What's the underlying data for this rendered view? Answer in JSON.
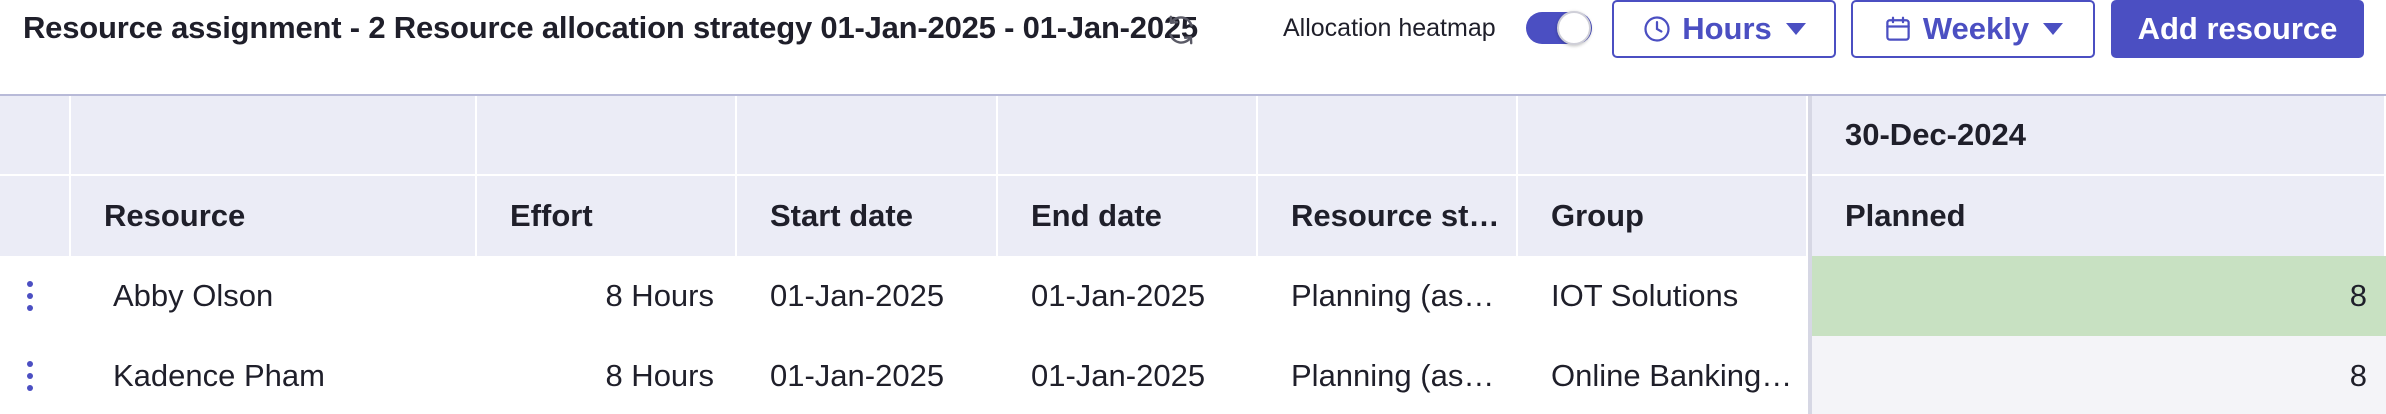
{
  "toolbar": {
    "title": "Resource assignment - 2 Resource allocation strategy 01-Jan-2025 - 01-Jan-2025",
    "heatmap_label": "Allocation heatmap",
    "heatmap_enabled": true,
    "hours_label": "Hours",
    "weekly_label": "Weekly",
    "add_resource_label": "Add resource"
  },
  "grid": {
    "timeline": {
      "week_label": "30-Dec-2024",
      "planned_label": "Planned"
    },
    "columns": [
      "Resource",
      "Effort",
      "Start date",
      "End date",
      "Resource st…",
      "Group"
    ],
    "rows": [
      {
        "resource": "Abby Olson",
        "effort": "8 Hours",
        "start_date": "01-Jan-2025",
        "end_date": "01-Jan-2025",
        "resource_state": "Planning (as…",
        "group": "IOT Solutions",
        "planned": "8"
      },
      {
        "resource": "Kadence Pham",
        "effort": "8 Hours",
        "start_date": "01-Jan-2025",
        "end_date": "01-Jan-2025",
        "resource_state": "Planning (as…",
        "group": "Online Banking…",
        "planned": "8"
      }
    ]
  },
  "colors": {
    "accent": "#4b4fc2",
    "header_bg": "#ebecf6",
    "heat_high": "#c8e1c2",
    "heat_low": "#f4f4f8"
  },
  "icons": {
    "refresh": "refresh-icon",
    "hours": "clock-icon",
    "weekly": "calendar-icon",
    "dropdown": "caret-down-icon",
    "row_menu": "vertical-dots-icon"
  }
}
